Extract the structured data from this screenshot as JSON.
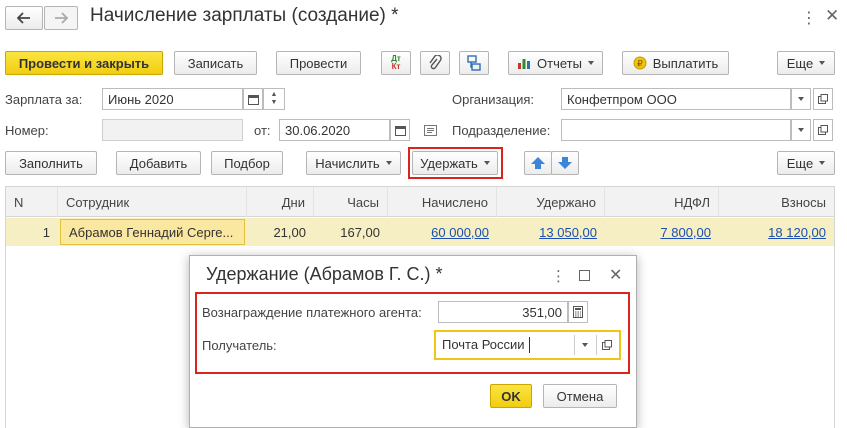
{
  "window": {
    "title": "Начисление зарплаты (создание) *",
    "back_icon": "arrow-left-icon",
    "forward_icon": "arrow-right-icon",
    "star_icon": "star-icon"
  },
  "toolbar": {
    "post_close": "Провести и закрыть",
    "save": "Записать",
    "post": "Провести",
    "dtkt_top": "Дт",
    "dtkt_bottom": "Кт",
    "reports": "Отчеты",
    "pay": "Выплатить",
    "more": "Еще"
  },
  "form": {
    "salary_for_label": "Зарплата за:",
    "salary_for_value": "Июнь 2020",
    "org_label": "Организация:",
    "org_value": "Конфетпром ООО",
    "number_label": "Номер:",
    "number_value": "",
    "date_label": "от:",
    "date_value": "30.06.2020",
    "division_label": "Подразделение:",
    "division_value": ""
  },
  "table_toolbar": {
    "fill": "Заполнить",
    "add": "Добавить",
    "select": "Подбор",
    "accrue": "Начислить",
    "withhold": "Удержать",
    "more": "Еще"
  },
  "table": {
    "headers": [
      "N",
      "Сотрудник",
      "Дни",
      "Часы",
      "Начислено",
      "Удержано",
      "НДФЛ",
      "Взносы"
    ],
    "rows": [
      [
        "1",
        "Абрамов Геннадий Серге...",
        "21,00",
        "167,00",
        "60 000,00",
        "13 050,00",
        "7 800,00",
        "18 120,00"
      ]
    ]
  },
  "dialog": {
    "title": "Удержание (Абрамов Г. С.) *",
    "fee_label": "Вознаграждение платежного агента:",
    "fee_value": "351,00",
    "recipient_label": "Получатель:",
    "recipient_value": "Почта России",
    "ok": "OK",
    "cancel": "Отмена"
  },
  "colors": {
    "primary_button": "#f1cd11",
    "highlight_red": "#d9261c",
    "selected_row": "#f7efc4",
    "link": "#1c4fb0",
    "arrow_blue": "#3b86d8"
  }
}
